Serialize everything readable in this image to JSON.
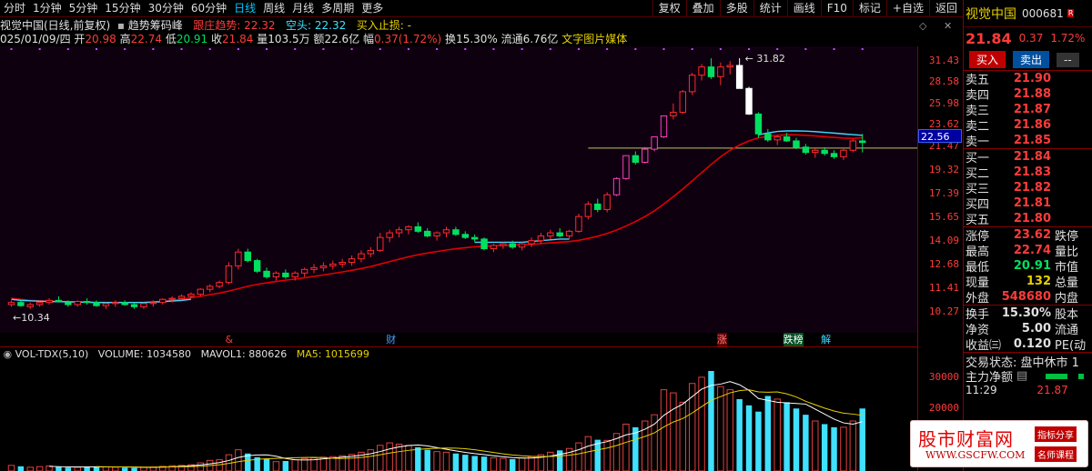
{
  "toolbar": {
    "items": [
      "分时",
      "1分钟",
      "5分钟",
      "15分钟",
      "30分钟",
      "60分钟",
      "日线",
      "周线",
      "月线",
      "多周期",
      "更多"
    ],
    "active_index": 6,
    "right_buttons": [
      "复权",
      "叠加",
      "多股",
      "统计",
      "画线",
      "F10",
      "标记",
      "+自选",
      "返回"
    ]
  },
  "info1": {
    "title": "视觉中国(日线,前复权)",
    "indicator": "趋势筹码峰",
    "trend_label": "跟庄趋势:",
    "trend_value": "22.32",
    "short_label": "空头:",
    "short_value": "22.32",
    "stop_label": "买入止损:",
    "stop_value": "-"
  },
  "info2": {
    "date": "025/01/09/四",
    "open_label": "开",
    "open": "20.98",
    "high_label": "高",
    "high": "22.74",
    "low_label": "低",
    "low": "20.91",
    "close_label": "收",
    "close": "21.84",
    "vol_label": "量",
    "vol": "103.5万",
    "amt_label": "额",
    "amt": "22.6亿",
    "amp_label": "幅",
    "amp": "0.37(1.72%)",
    "turn_label": "换",
    "turn": "15.30%",
    "float_label": "流通",
    "float": "6.76亿",
    "concepts": "文字图片媒体"
  },
  "chart_data": {
    "type": "candlestick",
    "ylim": [
      9.5,
      33.0
    ],
    "price_ticks": [
      "31.43",
      "28.58",
      "25.98",
      "23.62",
      "21.47",
      "19.32",
      "17.39",
      "15.65",
      "14.09",
      "12.68",
      "11.41",
      "10.27"
    ],
    "current_price_tag": "22.56",
    "max_label": "31.82",
    "min_label": "10.34",
    "horizontal_line": 21.3,
    "candles": [
      [
        10.6,
        10.8,
        10.5,
        10.7
      ],
      [
        10.7,
        10.8,
        10.5,
        10.55
      ],
      [
        10.5,
        10.7,
        10.4,
        10.6
      ],
      [
        10.6,
        10.75,
        10.5,
        10.7
      ],
      [
        10.7,
        10.9,
        10.6,
        10.8
      ],
      [
        10.8,
        11.0,
        10.7,
        10.75
      ],
      [
        10.7,
        10.8,
        10.5,
        10.6
      ],
      [
        10.6,
        10.8,
        10.5,
        10.75
      ],
      [
        10.75,
        10.9,
        10.6,
        10.7
      ],
      [
        10.7,
        10.8,
        10.5,
        10.55
      ],
      [
        10.55,
        10.7,
        10.4,
        10.65
      ],
      [
        10.65,
        10.8,
        10.5,
        10.7
      ],
      [
        10.7,
        10.8,
        10.55,
        10.6
      ],
      [
        10.6,
        10.7,
        10.4,
        10.5
      ],
      [
        10.5,
        10.7,
        10.4,
        10.65
      ],
      [
        10.65,
        10.8,
        10.5,
        10.7
      ],
      [
        10.7,
        10.9,
        10.6,
        10.85
      ],
      [
        10.85,
        11.0,
        10.7,
        10.9
      ],
      [
        10.9,
        11.1,
        10.8,
        11.0
      ],
      [
        11.0,
        11.2,
        10.9,
        11.1
      ],
      [
        11.1,
        11.4,
        11.0,
        11.35
      ],
      [
        11.35,
        11.6,
        11.2,
        11.5
      ],
      [
        11.5,
        11.8,
        11.4,
        11.7
      ],
      [
        11.7,
        12.8,
        11.6,
        12.6
      ],
      [
        12.6,
        13.6,
        12.4,
        13.4
      ],
      [
        13.4,
        13.6,
        12.8,
        12.9
      ],
      [
        12.9,
        13.0,
        12.2,
        12.3
      ],
      [
        12.3,
        12.5,
        11.9,
        12.0
      ],
      [
        12.0,
        12.3,
        11.8,
        12.2
      ],
      [
        12.2,
        12.4,
        11.9,
        12.0
      ],
      [
        12.0,
        12.3,
        11.8,
        12.2
      ],
      [
        12.2,
        12.5,
        12.0,
        12.4
      ],
      [
        12.4,
        12.7,
        12.2,
        12.5
      ],
      [
        12.5,
        12.8,
        12.3,
        12.6
      ],
      [
        12.6,
        12.9,
        12.4,
        12.7
      ],
      [
        12.7,
        13.0,
        12.5,
        12.8
      ],
      [
        12.8,
        13.2,
        12.6,
        13.0
      ],
      [
        13.0,
        13.5,
        12.8,
        13.3
      ],
      [
        13.3,
        13.7,
        13.1,
        13.5
      ],
      [
        13.5,
        14.6,
        13.4,
        14.3
      ],
      [
        14.3,
        14.8,
        14.0,
        14.6
      ],
      [
        14.6,
        15.0,
        14.3,
        14.8
      ],
      [
        14.8,
        15.1,
        14.5,
        15.0
      ],
      [
        15.0,
        15.3,
        14.6,
        14.7
      ],
      [
        14.7,
        14.9,
        14.3,
        14.4
      ],
      [
        14.4,
        14.7,
        14.1,
        14.6
      ],
      [
        14.6,
        15.0,
        14.3,
        14.8
      ],
      [
        14.8,
        15.0,
        14.4,
        14.5
      ],
      [
        14.5,
        14.7,
        14.2,
        14.3
      ],
      [
        14.3,
        14.5,
        14.0,
        14.2
      ],
      [
        14.2,
        14.3,
        13.5,
        13.6
      ],
      [
        13.6,
        13.9,
        13.4,
        13.8
      ],
      [
        13.8,
        14.0,
        13.6,
        13.9
      ],
      [
        13.9,
        14.1,
        13.6,
        13.7
      ],
      [
        13.7,
        14.0,
        13.5,
        13.9
      ],
      [
        13.9,
        14.3,
        13.7,
        14.1
      ],
      [
        14.1,
        14.6,
        13.9,
        14.4
      ],
      [
        14.4,
        14.8,
        14.2,
        14.6
      ],
      [
        14.6,
        14.9,
        14.3,
        14.4
      ],
      [
        14.4,
        14.8,
        14.2,
        14.7
      ],
      [
        14.7,
        15.9,
        14.6,
        15.7
      ],
      [
        15.7,
        16.8,
        15.5,
        16.6
      ],
      [
        16.6,
        17.0,
        16.0,
        16.2
      ],
      [
        16.2,
        17.5,
        16.0,
        17.3
      ],
      [
        17.3,
        18.7,
        17.2,
        18.6
      ],
      [
        18.6,
        20.6,
        18.5,
        20.6
      ],
      [
        20.6,
        21.0,
        19.8,
        20.0
      ],
      [
        20.0,
        21.4,
        19.9,
        21.2
      ],
      [
        21.2,
        22.4,
        21.0,
        22.4
      ],
      [
        22.4,
        24.6,
        22.3,
        24.6
      ],
      [
        24.6,
        26.0,
        24.2,
        25.0
      ],
      [
        25.0,
        27.6,
        24.8,
        27.4
      ],
      [
        27.4,
        29.8,
        27.0,
        29.5
      ],
      [
        29.5,
        31.0,
        28.8,
        30.6
      ],
      [
        30.6,
        31.8,
        29.0,
        29.3
      ],
      [
        29.3,
        31.2,
        28.2,
        30.6
      ],
      [
        30.6,
        31.4,
        29.6,
        30.8
      ],
      [
        30.8,
        31.82,
        27.8,
        27.8
      ],
      [
        27.8,
        28.0,
        24.7,
        24.8
      ],
      [
        24.8,
        25.0,
        22.3,
        22.7
      ],
      [
        22.7,
        23.2,
        21.9,
        22.1
      ],
      [
        22.1,
        22.6,
        21.6,
        22.4
      ],
      [
        22.4,
        22.8,
        21.9,
        22.0
      ],
      [
        22.0,
        22.3,
        21.2,
        21.4
      ],
      [
        21.4,
        21.7,
        20.7,
        20.9
      ],
      [
        20.9,
        21.3,
        20.4,
        21.1
      ],
      [
        21.1,
        21.4,
        20.6,
        20.8
      ],
      [
        20.8,
        21.1,
        20.3,
        20.5
      ],
      [
        20.5,
        21.3,
        20.2,
        21.1
      ],
      [
        21.1,
        22.2,
        20.9,
        22.0
      ],
      [
        22.0,
        22.7,
        20.9,
        21.84
      ]
    ],
    "ma_red": [
      10.9,
      10.85,
      10.8,
      10.78,
      10.76,
      10.75,
      10.74,
      10.73,
      10.72,
      10.71,
      10.7,
      10.7,
      10.7,
      10.7,
      10.7,
      10.72,
      10.75,
      10.8,
      10.86,
      10.93,
      11.0,
      11.08,
      11.16,
      11.26,
      11.38,
      11.5,
      11.6,
      11.68,
      11.75,
      11.82,
      11.88,
      11.95,
      12.02,
      12.1,
      12.18,
      12.26,
      12.35,
      12.45,
      12.56,
      12.7,
      12.84,
      12.98,
      13.12,
      13.24,
      13.34,
      13.43,
      13.52,
      13.6,
      13.66,
      13.72,
      13.75,
      13.78,
      13.8,
      13.82,
      13.84,
      13.87,
      13.91,
      13.96,
      14.0,
      14.04,
      14.12,
      14.24,
      14.38,
      14.56,
      14.78,
      15.05,
      15.35,
      15.7,
      16.1,
      16.6,
      17.15,
      17.75,
      18.4,
      19.1,
      19.8,
      20.5,
      21.1,
      21.6,
      22.0,
      22.3,
      22.45,
      22.55,
      22.6,
      22.6,
      22.56,
      22.5,
      22.42,
      22.34,
      22.28,
      22.25,
      22.32
    ],
    "ma_cyan": [
      10.85,
      10.8,
      10.78,
      10.76,
      10.75,
      10.74,
      10.73,
      10.72,
      10.71,
      10.7,
      10.7,
      10.7,
      10.7,
      10.7,
      10.7,
      10.72,
      10.74,
      10.77,
      10.8,
      10.85,
      null,
      null,
      null,
      null,
      null,
      null,
      null,
      null,
      null,
      null,
      null,
      null,
      null,
      null,
      null,
      null,
      null,
      null,
      null,
      null,
      null,
      null,
      null,
      null,
      null,
      null,
      null,
      null,
      null,
      14.0,
      14.0,
      14.0,
      14.0,
      14.0,
      14.0,
      14.05,
      14.1,
      14.15,
      14.2,
      14.2,
      null,
      null,
      null,
      null,
      null,
      null,
      null,
      null,
      null,
      null,
      null,
      null,
      null,
      null,
      null,
      null,
      null,
      null,
      null,
      22.6,
      22.8,
      22.95,
      23.0,
      23.0,
      22.98,
      22.93,
      22.86,
      22.78,
      22.7,
      22.62,
      22.56
    ],
    "event_labels": [
      {
        "i": 23,
        "text": "&"
      },
      {
        "i": 40,
        "text": "财"
      },
      {
        "i": 75,
        "text": "涨"
      },
      {
        "i": 82,
        "text": "跌榜"
      },
      {
        "i": 86,
        "text": "解"
      }
    ],
    "volume": {
      "ylim": [
        0,
        32000
      ],
      "ticks": [
        "30000",
        "20000"
      ],
      "bars": [
        1800,
        1500,
        1200,
        1400,
        1600,
        1300,
        1100,
        1200,
        1400,
        1500,
        1300,
        1200,
        1100,
        1000,
        1200,
        1300,
        1500,
        1700,
        1800,
        2000,
        2600,
        3400,
        3600,
        5200,
        6800,
        5600,
        4400,
        3800,
        3000,
        3200,
        3600,
        4000,
        4200,
        4400,
        4600,
        4900,
        5300,
        6000,
        6800,
        8200,
        9000,
        8600,
        8200,
        7600,
        6800,
        6200,
        6000,
        5600,
        5200,
        4800,
        4600,
        4200,
        4000,
        3800,
        4200,
        4600,
        5200,
        6000,
        6600,
        7200,
        9000,
        11000,
        10000,
        9800,
        12000,
        15000,
        14000,
        16000,
        18000,
        26000,
        25000,
        22000,
        28000,
        30000,
        32000,
        27000,
        26000,
        23000,
        21000,
        19000,
        24000,
        23000,
        22000,
        20000,
        18000,
        16000,
        15000,
        14000,
        14000,
        16000,
        20000
      ],
      "header": {
        "name": "VOL-TDX(5,10)",
        "vol_label": "VOLUME:",
        "vol": "1034580",
        "mavol_label": "MAVOL1:",
        "mavol": "880626",
        "ma5_label": "MA5:",
        "ma5": "1015699"
      }
    }
  },
  "panel": {
    "name": "视觉中国",
    "code": "000681",
    "badge": "R",
    "price": "21.84",
    "change": "0.37",
    "pct": "1.72%",
    "buttons": [
      "买入",
      "卖出",
      "--"
    ],
    "asks": [
      {
        "l": "卖五",
        "p": "21.90"
      },
      {
        "l": "卖四",
        "p": "21.88"
      },
      {
        "l": "卖三",
        "p": "21.87"
      },
      {
        "l": "卖二",
        "p": "21.86"
      },
      {
        "l": "卖一",
        "p": "21.85"
      }
    ],
    "bids": [
      {
        "l": "买一",
        "p": "21.84"
      },
      {
        "l": "买二",
        "p": "21.83"
      },
      {
        "l": "买三",
        "p": "21.82"
      },
      {
        "l": "买四",
        "p": "21.81"
      },
      {
        "l": "买五",
        "p": "21.80"
      }
    ],
    "stats1": [
      {
        "l": "涨停",
        "v": "23.62",
        "c": "#ff3b3b",
        "l2": "跌停"
      },
      {
        "l": "最高",
        "v": "22.74",
        "c": "#ff3b3b",
        "l2": "量比"
      },
      {
        "l": "最低",
        "v": "20.91",
        "c": "#00e060",
        "l2": "市值"
      },
      {
        "l": "现量",
        "v": "132",
        "c": "#e8d000",
        "l2": "总量"
      },
      {
        "l": "外盘",
        "v": "548680",
        "c": "#ff3b3b",
        "l2": "内盘"
      }
    ],
    "stats2": [
      {
        "l": "换手",
        "v": "15.30%",
        "c": "#e0e0e0",
        "l2": "股本"
      },
      {
        "l": "净资",
        "v": "5.00",
        "c": "#e0e0e0",
        "l2": "流通"
      },
      {
        "l": "收益㈢",
        "v": "0.120",
        "c": "#e0e0e0",
        "l2": "PE(动"
      }
    ],
    "status": "交易状态: 盘中休市 1",
    "net_label": "主力净额",
    "time": "11:29",
    "time_price": "21.87"
  },
  "watermark": {
    "main": "股市财富网",
    "url": "WWW.GSCFW.COM",
    "badge1": "指标分享",
    "badge2": "名师课程"
  }
}
